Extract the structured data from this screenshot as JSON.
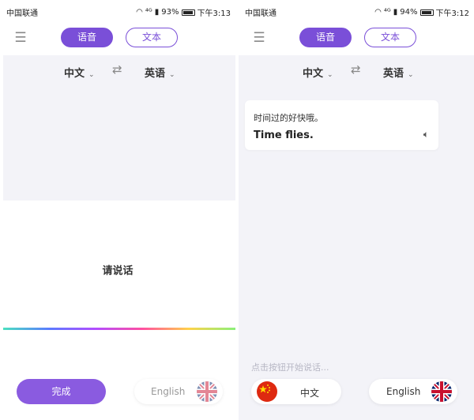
{
  "left": {
    "status": {
      "carrier": "中国联通",
      "network": "⁴ᴳ",
      "battery": "93%",
      "time": "下午3:13",
      "battery_level": 0.93
    },
    "tabs": {
      "voice": "语音",
      "text": "文本"
    },
    "languages": {
      "source": "中文",
      "target": "英语"
    },
    "prompt": "请说话",
    "done_button": "完成",
    "target_pill": {
      "label": "English",
      "flag": "uk-flag-icon"
    }
  },
  "right": {
    "status": {
      "carrier": "中国联通",
      "network": "⁴ᴳ",
      "battery": "94%",
      "time": "下午3:12",
      "battery_level": 0.94
    },
    "tabs": {
      "voice": "语音",
      "text": "文本"
    },
    "languages": {
      "source": "中文",
      "target": "英语"
    },
    "card": {
      "source_text": "时间过的好快哦。",
      "translation": "Time flies."
    },
    "hint": "点击按钮开始说话...",
    "source_pill": {
      "label": "中文",
      "flag": "china-flag-icon"
    },
    "target_pill": {
      "label": "English",
      "flag": "uk-flag-icon"
    }
  },
  "colors": {
    "accent": "#7a4fd8",
    "panel_bg": "#f3f3f8"
  }
}
